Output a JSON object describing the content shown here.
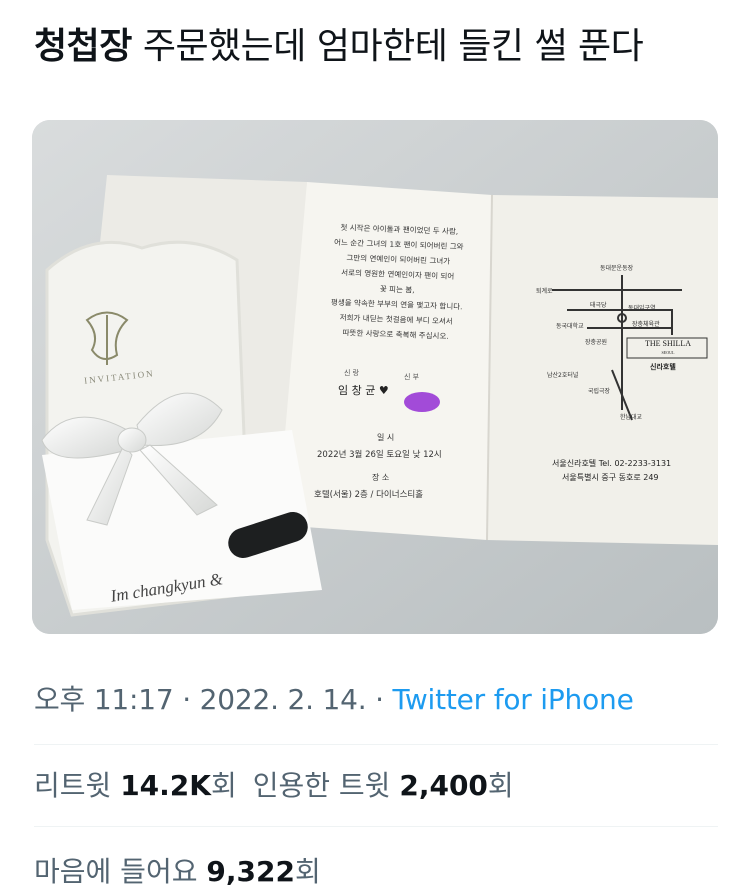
{
  "tweet": {
    "title_bold": "청첩장",
    "title_rest": " 주문했는데 엄마한테 들킨 썰 푼다",
    "time": "오후 11:17",
    "date": "2022. 2. 14.",
    "separator": " · ",
    "source": "Twitter for iPhone"
  },
  "stats": {
    "retweets_label": "리트윗",
    "retweets_value": "14.2K",
    "retweets_unit": "회",
    "quotes_label": "인용한 트윗",
    "quotes_value": "2,400",
    "quotes_unit": "회",
    "likes_label": "마음에 들어요",
    "likes_value": "9,322",
    "likes_unit": "회"
  },
  "invitation": {
    "cover_word": "INVITATION",
    "script_name": "Im changkyun &",
    "poem": [
      "첫 시작은 아이돌과 팬이었던 두 사람,",
      "어느 순간 그녀의 1호 팬이 되어버린 그와",
      "그만의 연예인이 되어버린 그녀가",
      "서로의 영원한 연예인이자 팬이 되어",
      "꽃 피는 봄,",
      "평생을 약속한 부부의 연을 맺고자 합니다.",
      "저희가 내딛는 첫걸음에 부디 오셔서",
      "따뜻한 사랑으로 축복해 주십시오."
    ],
    "groom_label": "신 랑",
    "bride_label": "신 부",
    "groom_name": "임 창 균",
    "heart": "♥",
    "date_label": "일 시",
    "date_text": "2022년 3월 26일 토요일 낮 12시",
    "place_label": "장 소",
    "place_text": "호텔(서울) 2층 / 다이너스티홀",
    "map_labels": [
      "동대문운동장",
      "퇴계로",
      "태극당",
      "동대입구역",
      "동국대학교",
      "장충체육관",
      "장충공원",
      "남산2호터널",
      "국립극장",
      "한남대교"
    ],
    "hotel_logo": "THE SHILLA",
    "hotel_logo_sub": "SEOUL",
    "hotel_korean": "신라호텔",
    "hotel_contact": "서울신라호텔  Tel. 02-2233-3131",
    "hotel_address": "서울특별시 중구 동호로 249"
  },
  "colors": {
    "link": "#1d9bf0",
    "muted": "#536471",
    "text": "#0f1419",
    "divider": "#eff3f4"
  }
}
